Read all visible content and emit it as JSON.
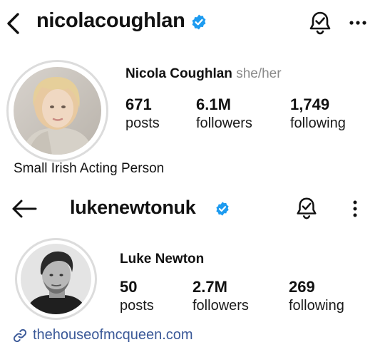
{
  "profile1": {
    "username": "nicolacoughlan",
    "name": "Nicola Coughlan",
    "pronouns": "she/her",
    "stats": {
      "posts": {
        "value": "671",
        "label": "posts"
      },
      "followers": {
        "value": "6.1M",
        "label": "followers"
      },
      "following": {
        "value": "1,749",
        "label": "following"
      }
    },
    "bio": "Small Irish Acting Person",
    "icons": {
      "back": "chevron-left-icon",
      "verified": "verified-badge-icon",
      "notifications": "bell-check-icon",
      "more": "more-horizontal-icon"
    }
  },
  "profile2": {
    "username": "lukenewtonuk",
    "name": "Luke Newton",
    "stats": {
      "posts": {
        "value": "50",
        "label": "posts"
      },
      "followers": {
        "value": "2.7M",
        "label": "followers"
      },
      "following": {
        "value": "269",
        "label": "following"
      }
    },
    "link": "thehouseofmcqueen.com",
    "icons": {
      "back": "arrow-left-icon",
      "verified": "verified-badge-icon",
      "notifications": "bell-check-icon",
      "more": "more-vertical-icon",
      "link": "link-icon"
    }
  },
  "colors": {
    "verified": "#1d9bf0",
    "link": "#3b5998",
    "muted": "#8a8a8a"
  }
}
